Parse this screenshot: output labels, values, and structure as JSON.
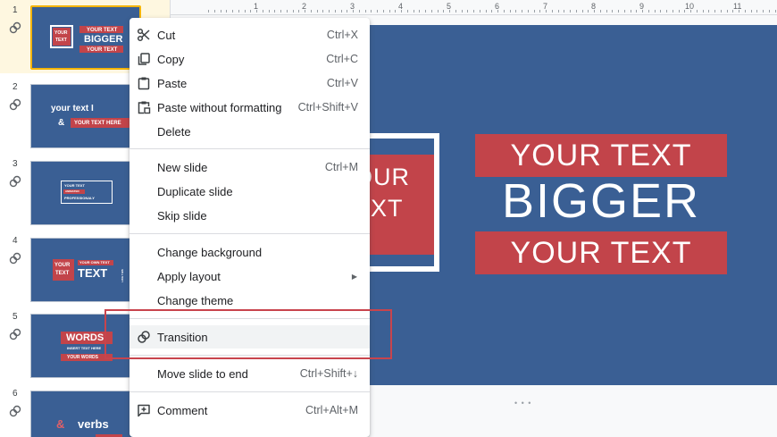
{
  "filmstrip": {
    "slides": [
      {
        "number": "1",
        "texts": [
          "YOUR",
          "TEXT",
          "YOUR TEXT",
          "BIGGER",
          "YOUR TEXT"
        ]
      },
      {
        "number": "2",
        "texts": [
          "your text I",
          "&",
          "YOUR TEXT HERE"
        ]
      },
      {
        "number": "3",
        "texts": [
          "YOUR TEXT",
          "ANIMATED",
          "PROFESSIONALY"
        ]
      },
      {
        "number": "4",
        "texts": [
          "YOUR",
          "TEXT",
          "YOUR OWN TEXT",
          "TEXT",
          "LIKE THIS"
        ]
      },
      {
        "number": "5",
        "texts": [
          "WORDS",
          "INSERT TEXT HERE",
          "YOUR WORDS"
        ]
      },
      {
        "number": "6",
        "texts": [
          "&",
          "verbs"
        ]
      }
    ]
  },
  "ruler": {
    "marks": [
      "1",
      "2",
      "3",
      "4",
      "5",
      "6",
      "7",
      "8",
      "9",
      "10",
      "11"
    ]
  },
  "slide": {
    "square_text_1": "OUR",
    "square_text_2": "EXT",
    "banner_top": "YOUR TEXT",
    "big_text": "BIGGER",
    "banner_bottom": "YOUR TEXT",
    "bg_color": "#3a5f94",
    "accent_color": "#c2444a"
  },
  "context_menu": {
    "items": [
      {
        "label": "Cut",
        "shortcut": "Ctrl+X",
        "icon": "scissors-icon"
      },
      {
        "label": "Copy",
        "shortcut": "Ctrl+C",
        "icon": "copy-icon"
      },
      {
        "label": "Paste",
        "shortcut": "Ctrl+V",
        "icon": "clipboard-icon"
      },
      {
        "label": "Paste without formatting",
        "shortcut": "Ctrl+Shift+V",
        "icon": "paste-plain-icon"
      },
      {
        "label": "Delete",
        "shortcut": "",
        "icon": ""
      },
      {
        "label": "New slide",
        "shortcut": "Ctrl+M",
        "icon": ""
      },
      {
        "label": "Duplicate slide",
        "shortcut": "",
        "icon": ""
      },
      {
        "label": "Skip slide",
        "shortcut": "",
        "icon": ""
      },
      {
        "label": "Change background",
        "shortcut": "",
        "icon": ""
      },
      {
        "label": "Apply layout",
        "shortcut": "",
        "icon": "",
        "submenu": true
      },
      {
        "label": "Change theme",
        "shortcut": "",
        "icon": ""
      },
      {
        "label": "Transition",
        "shortcut": "",
        "icon": "transition-icon",
        "highlighted": true
      },
      {
        "label": "Move slide to end",
        "shortcut": "Ctrl+Shift+↓",
        "icon": ""
      },
      {
        "label": "Comment",
        "shortcut": "Ctrl+Alt+M",
        "icon": "comment-add-icon"
      }
    ],
    "highlight_color": "#c8444d"
  }
}
